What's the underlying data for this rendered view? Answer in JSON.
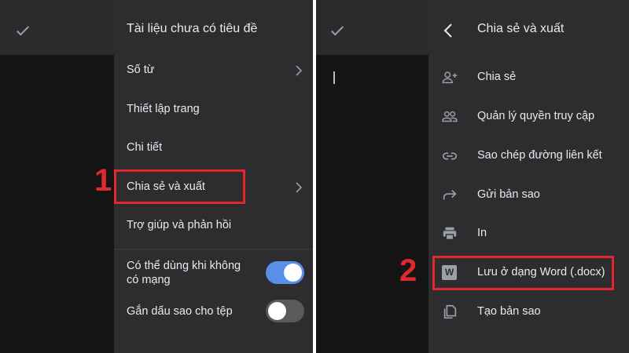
{
  "left": {
    "drawer_title": "Tài liệu chưa có tiêu đề",
    "menu": [
      {
        "label": "Số từ",
        "has_chevron": true
      },
      {
        "label": "Thiết lập trang",
        "has_chevron": false
      },
      {
        "label": "Chi tiết",
        "has_chevron": false
      },
      {
        "label": "Chia sẻ và xuất",
        "has_chevron": true
      },
      {
        "label": "Trợ giúp và phản hồi",
        "has_chevron": false
      }
    ],
    "toggles": [
      {
        "label_line1": "Có thể dùng khi không",
        "label_line2": "có mạng",
        "on": true
      },
      {
        "label": "Gắn dấu sao cho tệp",
        "on": false
      }
    ]
  },
  "right": {
    "drawer_title": "Chia sẻ và xuất",
    "items": [
      {
        "label": "Chia sẻ",
        "icon": "person-add-icon"
      },
      {
        "label": "Quản lý quyền truy cập",
        "icon": "people-icon"
      },
      {
        "label": "Sao chép đường liên kết",
        "icon": "link-icon"
      },
      {
        "label": "Gửi bản sao",
        "icon": "forward-arrow-icon"
      },
      {
        "label": "In",
        "icon": "printer-icon"
      },
      {
        "label": "Lưu ở dạng Word (.docx)",
        "icon": "word-icon",
        "icon_text": "W"
      },
      {
        "label": "Tạo bản sao",
        "icon": "copy-icon"
      }
    ]
  },
  "annotations": {
    "step1": "1",
    "step2": "2",
    "color": "#e0282e"
  },
  "colors": {
    "drawer_bg": "#2d2d30",
    "doc_bg": "#141414",
    "toggle_on": "#5b8ee6",
    "toggle_off": "#5a5a5d"
  }
}
